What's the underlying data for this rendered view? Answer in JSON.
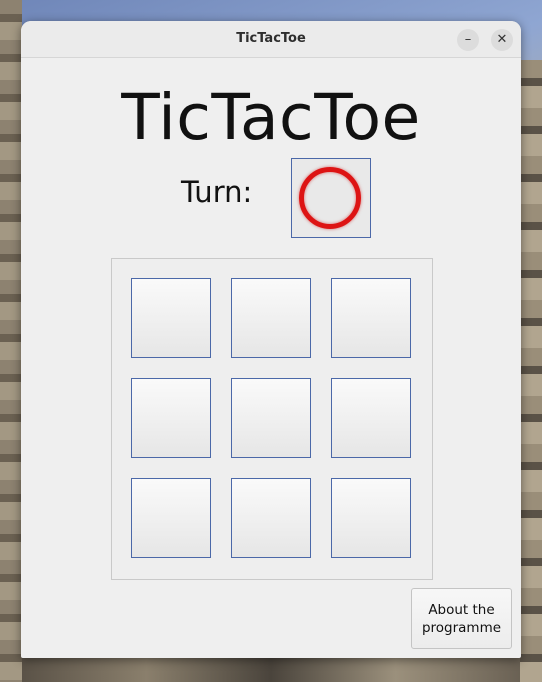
{
  "window": {
    "title": "TicTacToe",
    "minimize_symbol": "–",
    "close_symbol": "✕"
  },
  "game": {
    "heading": "TicTacToe",
    "turn_label": "Turn:",
    "current_turn": "circle",
    "turn_color": "#dd1414",
    "cell_border_color": "#4b68a8",
    "board": [
      "",
      "",
      "",
      "",
      "",
      "",
      "",
      "",
      ""
    ]
  },
  "about_button": {
    "label": "About the\nprogramme"
  }
}
